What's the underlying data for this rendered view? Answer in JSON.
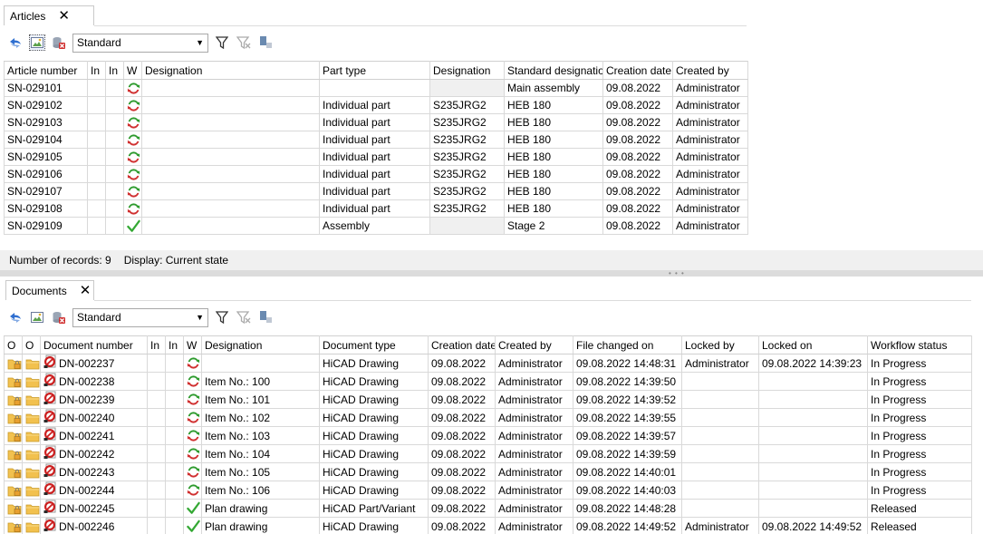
{
  "articles": {
    "tab_label": "Articles",
    "view_select": "Standard",
    "columns": [
      "Article number",
      "In",
      "In",
      "W",
      "Designation",
      "Part type",
      "Designation",
      "Standard designatio",
      "Creation date",
      "Created by"
    ],
    "rows": [
      {
        "article_number": "SN-029101",
        "status": "refresh",
        "designation": "",
        "part_type": "",
        "material": "",
        "standard": "Main assembly",
        "created": "09.08.2022",
        "by": "Administrator"
      },
      {
        "article_number": "SN-029102",
        "status": "refresh",
        "designation": "",
        "part_type": "Individual part",
        "material": "S235JRG2",
        "standard": "HEB 180",
        "created": "09.08.2022",
        "by": "Administrator"
      },
      {
        "article_number": "SN-029103",
        "status": "refresh",
        "designation": "",
        "part_type": "Individual part",
        "material": "S235JRG2",
        "standard": "HEB 180",
        "created": "09.08.2022",
        "by": "Administrator"
      },
      {
        "article_number": "SN-029104",
        "status": "refresh",
        "designation": "",
        "part_type": "Individual part",
        "material": "S235JRG2",
        "standard": "HEB 180",
        "created": "09.08.2022",
        "by": "Administrator"
      },
      {
        "article_number": "SN-029105",
        "status": "refresh",
        "designation": "",
        "part_type": "Individual part",
        "material": "S235JRG2",
        "standard": "HEB 180",
        "created": "09.08.2022",
        "by": "Administrator"
      },
      {
        "article_number": "SN-029106",
        "status": "refresh",
        "designation": "",
        "part_type": "Individual part",
        "material": "S235JRG2",
        "standard": "HEB 180",
        "created": "09.08.2022",
        "by": "Administrator"
      },
      {
        "article_number": "SN-029107",
        "status": "refresh",
        "designation": "",
        "part_type": "Individual part",
        "material": "S235JRG2",
        "standard": "HEB 180",
        "created": "09.08.2022",
        "by": "Administrator"
      },
      {
        "article_number": "SN-029108",
        "status": "refresh",
        "designation": "",
        "part_type": "Individual part",
        "material": "S235JRG2",
        "standard": "HEB 180",
        "created": "09.08.2022",
        "by": "Administrator"
      },
      {
        "article_number": "SN-029109",
        "status": "check",
        "designation": "",
        "part_type": "Assembly",
        "material": "",
        "standard": "Stage 2",
        "created": "09.08.2022",
        "by": "Administrator"
      }
    ]
  },
  "statusbar": {
    "records": "Number of records: 9",
    "display": "Display: Current state"
  },
  "documents": {
    "tab_label": "Documents",
    "view_select": "Standard",
    "columns": [
      "O",
      "O",
      "Document number",
      "In",
      "In",
      "W",
      "Designation",
      "Document type",
      "Creation date",
      "Created by",
      "File changed on",
      "Locked by",
      "Locked on",
      "Workflow status"
    ],
    "rows": [
      {
        "doc_number": "DN-002237",
        "status": "refresh",
        "designation": "",
        "doc_type": "HiCAD Drawing",
        "created": "09.08.2022",
        "by": "Administrator",
        "changed": "09.08.2022 14:48:31",
        "locked_by": "Administrator",
        "locked_on": "09.08.2022 14:39:23",
        "workflow": "In Progress"
      },
      {
        "doc_number": "DN-002238",
        "status": "refresh",
        "designation": "Item No.: 100",
        "doc_type": "HiCAD Drawing",
        "created": "09.08.2022",
        "by": "Administrator",
        "changed": "09.08.2022 14:39:50",
        "locked_by": "",
        "locked_on": "",
        "workflow": "In Progress"
      },
      {
        "doc_number": "DN-002239",
        "status": "refresh",
        "designation": "Item No.: 101",
        "doc_type": "HiCAD Drawing",
        "created": "09.08.2022",
        "by": "Administrator",
        "changed": "09.08.2022 14:39:52",
        "locked_by": "",
        "locked_on": "",
        "workflow": "In Progress"
      },
      {
        "doc_number": "DN-002240",
        "status": "refresh",
        "designation": "Item No.: 102",
        "doc_type": "HiCAD Drawing",
        "created": "09.08.2022",
        "by": "Administrator",
        "changed": "09.08.2022 14:39:55",
        "locked_by": "",
        "locked_on": "",
        "workflow": "In Progress"
      },
      {
        "doc_number": "DN-002241",
        "status": "refresh",
        "designation": "Item No.: 103",
        "doc_type": "HiCAD Drawing",
        "created": "09.08.2022",
        "by": "Administrator",
        "changed": "09.08.2022 14:39:57",
        "locked_by": "",
        "locked_on": "",
        "workflow": "In Progress"
      },
      {
        "doc_number": "DN-002242",
        "status": "refresh",
        "designation": "Item No.: 104",
        "doc_type": "HiCAD Drawing",
        "created": "09.08.2022",
        "by": "Administrator",
        "changed": "09.08.2022 14:39:59",
        "locked_by": "",
        "locked_on": "",
        "workflow": "In Progress"
      },
      {
        "doc_number": "DN-002243",
        "status": "refresh",
        "designation": "Item No.: 105",
        "doc_type": "HiCAD Drawing",
        "created": "09.08.2022",
        "by": "Administrator",
        "changed": "09.08.2022 14:40:01",
        "locked_by": "",
        "locked_on": "",
        "workflow": "In Progress"
      },
      {
        "doc_number": "DN-002244",
        "status": "refresh",
        "designation": "Item No.: 106",
        "doc_type": "HiCAD Drawing",
        "created": "09.08.2022",
        "by": "Administrator",
        "changed": "09.08.2022 14:40:03",
        "locked_by": "",
        "locked_on": "",
        "workflow": "In Progress"
      },
      {
        "doc_number": "DN-002245",
        "status": "check",
        "designation": "Plan drawing",
        "doc_type": "HiCAD Part/Variant",
        "created": "09.08.2022",
        "by": "Administrator",
        "changed": "09.08.2022 14:48:28",
        "locked_by": "",
        "locked_on": "",
        "workflow": "Released"
      },
      {
        "doc_number": "DN-002246",
        "status": "check",
        "designation": "Plan drawing",
        "doc_type": "HiCAD Drawing",
        "created": "09.08.2022",
        "by": "Administrator",
        "changed": "09.08.2022 14:49:52",
        "locked_by": "Administrator",
        "locked_on": "09.08.2022 14:49:52",
        "workflow": "Released"
      }
    ]
  },
  "icons": {
    "toolbar": [
      "sync-icon",
      "image-icon",
      "delete-db-icon",
      "filter-icon",
      "clear-filter-icon",
      "columns-icon"
    ],
    "row": [
      "lock-folder-icon",
      "folder-icon",
      "no-entry-doc-icon",
      "refresh-icon",
      "check-icon"
    ]
  },
  "colors": {
    "refresh_green": "#2e9b2e",
    "refresh_red": "#d03030",
    "check_green": "#33a833",
    "folder": "#f2c14e",
    "grid_line": "#d9d9d9"
  }
}
